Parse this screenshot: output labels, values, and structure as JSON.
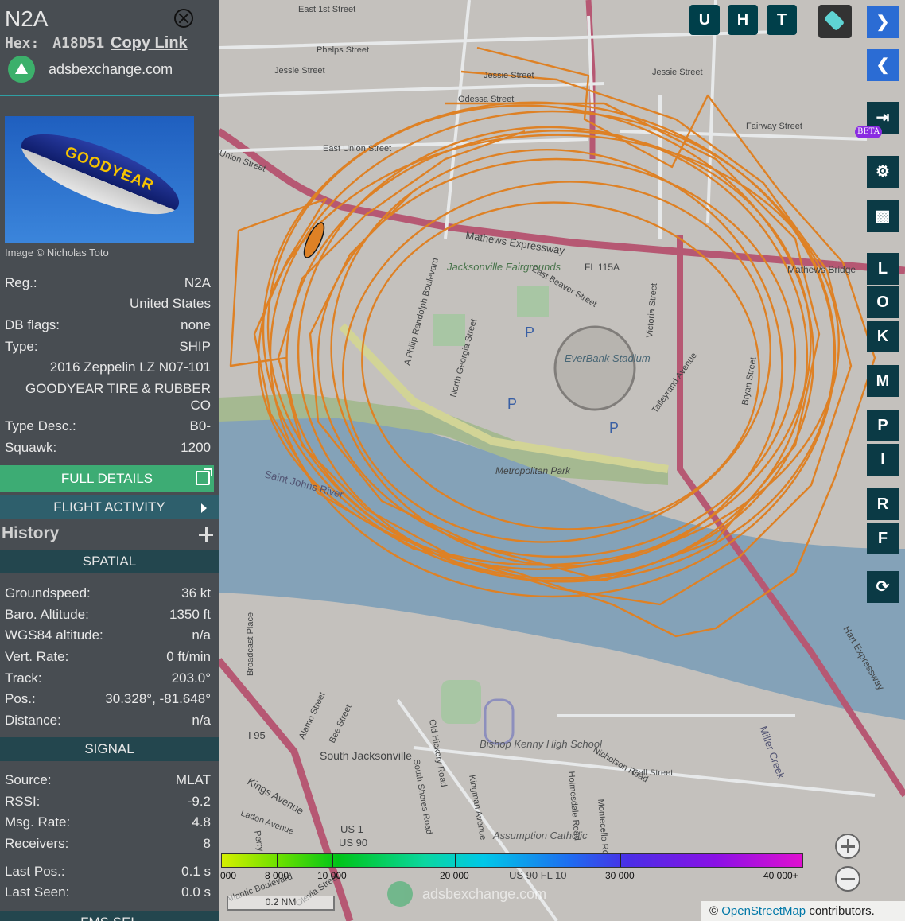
{
  "aircraft": {
    "registration": "N2A",
    "hex_label": "Hex:",
    "hex": "A18D51",
    "copy_link": "Copy Link",
    "source_site": "adsbexchange.com",
    "image_credit": "Image © Nicholas Toto",
    "photo_text": "GOODYEAR"
  },
  "details": {
    "reg_label": "Reg.:",
    "reg": "N2A",
    "country": "United States",
    "db_flags_label": "DB flags:",
    "db_flags": "none",
    "type_label": "Type:",
    "type": "SHIP",
    "model": "2016 Zeppelin LZ N07-101",
    "operator_line1": "GOODYEAR TIRE & RUBBER",
    "operator_line2": "CO",
    "type_desc_label": "Type Desc.:",
    "type_desc": "B0-",
    "squawk_label": "Squawk:",
    "squawk": "1200"
  },
  "buttons": {
    "full_details": "FULL DETAILS",
    "flight_activity": "FLIGHT ACTIVITY",
    "history": "History"
  },
  "spatial": {
    "header": "SPATIAL",
    "groundspeed_label": "Groundspeed:",
    "groundspeed": "36 kt",
    "baro_label": "Baro. Altitude:",
    "baro": "1350 ft",
    "wgs_label": "WGS84 altitude:",
    "wgs": "n/a",
    "vert_label": "Vert. Rate:",
    "vert": "0 ft/min",
    "track_label": "Track:",
    "track": "203.0°",
    "pos_label": "Pos.:",
    "pos": "30.328°, -81.648°",
    "distance_label": "Distance:",
    "distance": "n/a"
  },
  "signal": {
    "header": "SIGNAL",
    "source_label": "Source:",
    "source": "MLAT",
    "rssi_label": "RSSI:",
    "rssi": "-9.2",
    "msg_label": "Msg. Rate:",
    "msg": "4.8",
    "receivers_label": "Receivers:",
    "receivers": "8",
    "lastpos_label": "Last Pos.:",
    "lastpos": "0.1 s",
    "lastseen_label": "Last Seen:",
    "lastseen": "0.0 s",
    "next_header": "FMS SEL"
  },
  "map_controls": {
    "top": [
      "U",
      "H",
      "T"
    ],
    "side": [
      "L",
      "O",
      "K",
      "M",
      "P",
      "I",
      "R",
      "F"
    ],
    "beta": "BETA"
  },
  "map_labels": {
    "streets": [
      "East 1st Street",
      "Phelps Street",
      "Jessie Street",
      "Jessie Street",
      "Jessie Street",
      "Odessa Street",
      "Fairway Street",
      "East Union Street",
      "Union Street",
      "Mathews Expressway",
      "FL 115A",
      "Mathews Bridge",
      "East Beaver Street",
      "A Philip Randolph Boulevard",
      "North Georgia Street",
      "Victoria Street",
      "Talleyrand Avenue",
      "Bryan Street",
      "Saint Johns River",
      "Metropolitan Park",
      "Hart Expressway",
      "Broadcast Place",
      "Alamo Street",
      "Bee Street",
      "South Jacksonville",
      "Old Hickory Road",
      "South Shores Road",
      "Kingman Avenue",
      "Holmesdale Road",
      "Montecello Road",
      "Nicholson Road",
      "Call Street",
      "Miller Creek",
      "Kings Avenue",
      "Ladon Avenue",
      "Olevia Street",
      "Atlantic Boulevard",
      "Perry"
    ],
    "places": [
      "Jacksonville Fairgrounds",
      "EverBank Stadium",
      "Bishop Kenny High School",
      "Assumption Catholic"
    ],
    "shields": [
      "US 1",
      "US 90",
      "I 95",
      "US 90 FL 10"
    ],
    "parking": "P"
  },
  "legend": {
    "labels": [
      "000",
      "8 000",
      "10 000",
      "20 000",
      "30 000",
      "40 000+"
    ]
  },
  "scale": "0.2 NM",
  "attribution": {
    "prefix": "©",
    "link": "OpenStreetMap",
    "suffix": "contributors."
  },
  "watermark": "adsbexchange.com",
  "colors": {
    "track": "#f5891f",
    "panel": "#484d52",
    "accent_green": "#3dac74",
    "section_band": "#23464e",
    "button_dark": "#003f4a"
  }
}
